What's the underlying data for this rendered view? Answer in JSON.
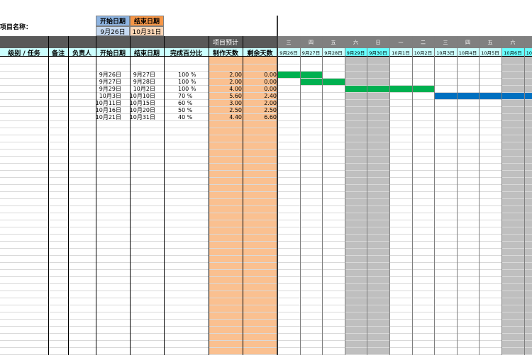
{
  "project": {
    "name_label": "项目名称："
  },
  "summary": {
    "start_label": "开始日期",
    "end_label": "结束日期",
    "start_value": "9月26日",
    "end_value": "10月31日"
  },
  "band": {
    "forecast_label": "项目预计"
  },
  "headers": {
    "level_task": "级别 / 任务",
    "notes": "备注",
    "owner": "负责人",
    "start": "开始日期",
    "end": "结束日期",
    "percent": "完成百分比",
    "days": "制作天数",
    "remaining": "剩余天数"
  },
  "timeline": [
    {
      "weekday": "三",
      "date": "9月26日",
      "weekend": false
    },
    {
      "weekday": "四",
      "date": "9月27日",
      "weekend": false
    },
    {
      "weekday": "五",
      "date": "9月28日",
      "weekend": false
    },
    {
      "weekday": "六",
      "date": "9月29日",
      "weekend": true
    },
    {
      "weekday": "日",
      "date": "9月30日",
      "weekend": true
    },
    {
      "weekday": "一",
      "date": "10月1日",
      "weekend": false
    },
    {
      "weekday": "二",
      "date": "10月2日",
      "weekend": false
    },
    {
      "weekday": "三",
      "date": "10月3日",
      "weekend": false
    },
    {
      "weekday": "四",
      "date": "10月4日",
      "weekend": false
    },
    {
      "weekday": "五",
      "date": "10月5日",
      "weekend": false
    },
    {
      "weekday": "六",
      "date": "10月6日",
      "weekend": true
    },
    {
      "weekday": "日",
      "date": "10月7日",
      "weekend": true
    }
  ],
  "tasks": [
    {
      "start": "9月26日",
      "end": "9月27日",
      "percent": "100 %",
      "days": "2.00",
      "remaining": "0.00",
      "bar": {
        "from": 0,
        "span": 2,
        "color": "green"
      }
    },
    {
      "start": "9月27日",
      "end": "9月28日",
      "percent": "100 %",
      "days": "2.00",
      "remaining": "0.00",
      "bar": {
        "from": 1,
        "span": 2,
        "color": "green"
      }
    },
    {
      "start": "9月29日",
      "end": "10月2日",
      "percent": "100 %",
      "days": "4.00",
      "remaining": "0.00",
      "bar": {
        "from": 3,
        "span": 4,
        "color": "green"
      }
    },
    {
      "start": "10月3日",
      "end": "10月10日",
      "percent": "70 %",
      "days": "5.60",
      "remaining": "2.40",
      "bar": {
        "from": 7,
        "span": 5,
        "color": "blue"
      }
    },
    {
      "start": "10月11日",
      "end": "10月15日",
      "percent": "60 %",
      "days": "3.00",
      "remaining": "2.00",
      "bar": null
    },
    {
      "start": "10月16日",
      "end": "10月20日",
      "percent": "50 %",
      "days": "2.50",
      "remaining": "2.50",
      "bar": null
    },
    {
      "start": "10月21日",
      "end": "10月31日",
      "percent": "40 %",
      "days": "4.40",
      "remaining": "6.60",
      "bar": null
    }
  ],
  "colors": {
    "header_dark": "#595959",
    "timeline_header": "#808080",
    "label_cyan": "#CCFFFF",
    "weekend_cyan": "#66FFFF",
    "start_box": "#8DB4E2",
    "start_value_bg": "#C5D9F1",
    "end_box": "#F79646",
    "end_value_bg": "#FCD5B4",
    "orange_col": "#FAC090",
    "weekend_gray": "#BFBFBF",
    "bar_green": "#00B050",
    "bar_blue": "#0070C0"
  }
}
